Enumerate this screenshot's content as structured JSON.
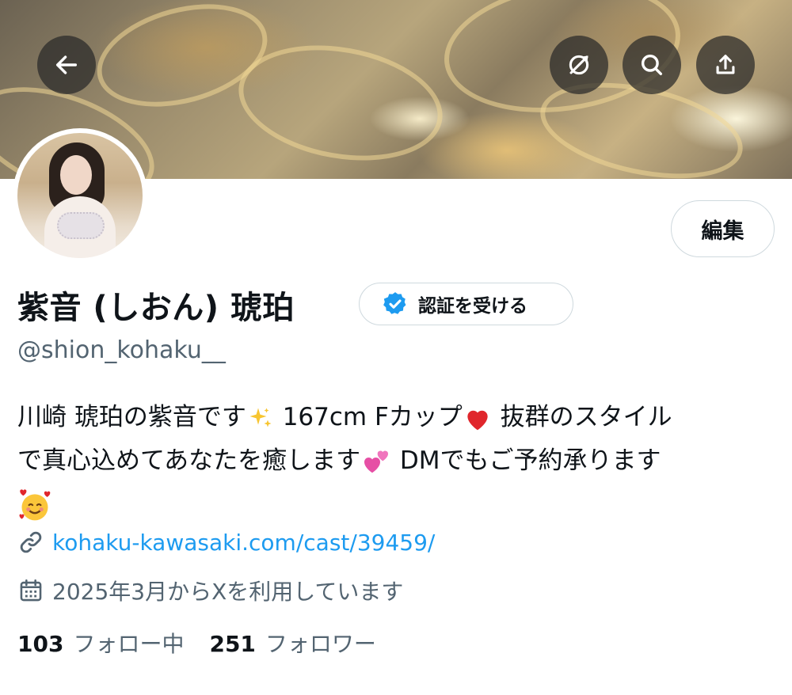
{
  "header": {
    "back_icon": "arrow-left-icon",
    "translate_icon": "no-translate-icon",
    "search_icon": "search-icon",
    "share_icon": "share-icon"
  },
  "profile": {
    "name": "紫音 (しおん) 琥珀",
    "handle": "@shion_kohaku__",
    "edit_label": "編集",
    "verify_label": "認証を受ける",
    "bio_line1": "川崎 琥珀の紫音です",
    "bio_line1b": " 167cm Fカップ",
    "bio_line1c": " 抜群のスタイル",
    "bio_line2": "で真心込めてあなたを癒します",
    "bio_line2b": " DMでもご予約承ります",
    "website": "kohaku-kawasaki.com/cast/39459/",
    "joined": "2025年3月からXを利用しています",
    "following_count": "103",
    "following_label": "フォロー中",
    "followers_count": "251",
    "followers_label": "フォロワー"
  },
  "colors": {
    "accent": "#1d9bf0",
    "secondary_text": "#536471",
    "border": "#cfd9de"
  }
}
